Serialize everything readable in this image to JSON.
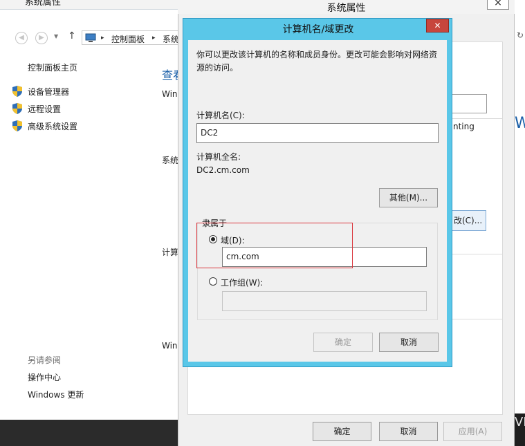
{
  "control_panel": {
    "window_title": "系统属性",
    "address": {
      "crumbs": [
        "控制面板",
        "系统"
      ]
    },
    "sidebar": {
      "home": "控制面板主页",
      "items": [
        {
          "label": "设备管理器",
          "icon": "shield-icon"
        },
        {
          "label": "远程设置",
          "icon": "shield-icon"
        },
        {
          "label": "高级系统设置",
          "icon": "shield-icon"
        }
      ],
      "see_also": "另请参阅",
      "see_also_links": [
        "操作中心",
        "Windows 更新"
      ]
    },
    "main_fragments": {
      "heading": "查看",
      "frag_win1": "Win",
      "frag_sys": "系统",
      "frag_comp": "计算",
      "frag_win2": "Win"
    }
  },
  "system_properties": {
    "title": "系统属性",
    "close": "×",
    "counting_fragment": "nting",
    "change_fragment": "改(C)...",
    "buttons": {
      "ok": "确定",
      "cancel": "取消",
      "apply": "应用(A)"
    }
  },
  "right_edge": {
    "fragment_top": "Wi",
    "fragment_bottom": "VI"
  },
  "computer_name_dialog": {
    "title": "计算机名/域更改",
    "close": "✕",
    "description_line1": "你可以更改该计算机的名称和成员身份。更改可能会影响对网络资",
    "description_line2": "源的访问。",
    "computer_name_label": "计算机名(C):",
    "computer_name_value": "DC2",
    "full_name_label": "计算机全名:",
    "full_name_value": "DC2.cm.com",
    "more_button": "其他(M)...",
    "member_of_legend": "隶属于",
    "domain_label": "域(D):",
    "domain_value": "cm.com",
    "domain_selected": true,
    "workgroup_label": "工作组(W):",
    "workgroup_value": "",
    "ok": "确定",
    "cancel": "取消"
  },
  "colors": {
    "dialog_accent": "#5ac7e8",
    "close_red": "#c7463d",
    "highlight_red": "#d9343a",
    "link_blue": "#1a5fa8"
  }
}
